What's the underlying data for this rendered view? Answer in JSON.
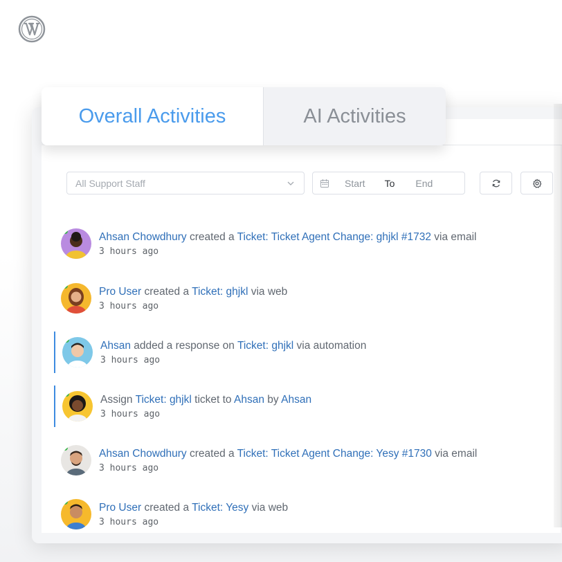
{
  "tabs": [
    {
      "label": "Overall Activities",
      "active": true
    },
    {
      "label": "AI Activities",
      "active": false
    }
  ],
  "filters": {
    "staff_placeholder": "All Support Staff",
    "date_start": "Start",
    "date_to": "To",
    "date_end": "End"
  },
  "colors": {
    "accent": "#4a9bec",
    "link": "#2f6fb8",
    "online": "#39b54a",
    "marker": "#3d8be0"
  },
  "activities": [
    {
      "actor": "Ahsan Chowdhury",
      "verb": "created a",
      "object": "Ticket: Ticket Agent Change: ghjkl #1732",
      "via": "via email",
      "time": "3 hours ago"
    },
    {
      "actor": "Pro User",
      "verb": "created a",
      "object": "Ticket: ghjkl",
      "via": "via web",
      "time": "3 hours ago"
    },
    {
      "actor": "Ahsan",
      "verb": "added a response on",
      "object": "Ticket: ghjkl",
      "via": "via automation",
      "time": "3 hours ago"
    },
    {
      "prefix": "Assign",
      "object": "Ticket: ghjkl",
      "mid": "ticket to",
      "target": "Ahsan",
      "by": "by",
      "by_user": "Ahsan",
      "time": "3 hours ago"
    },
    {
      "actor": "Ahsan Chowdhury",
      "verb": "created a",
      "object": "Ticket: Ticket Agent Change: Yesy #1730",
      "via": "via email",
      "time": "3 hours ago"
    },
    {
      "actor": "Pro User",
      "verb": "created a",
      "object": "Ticket: Yesy",
      "via": "via web",
      "time": "3 hours ago"
    }
  ]
}
